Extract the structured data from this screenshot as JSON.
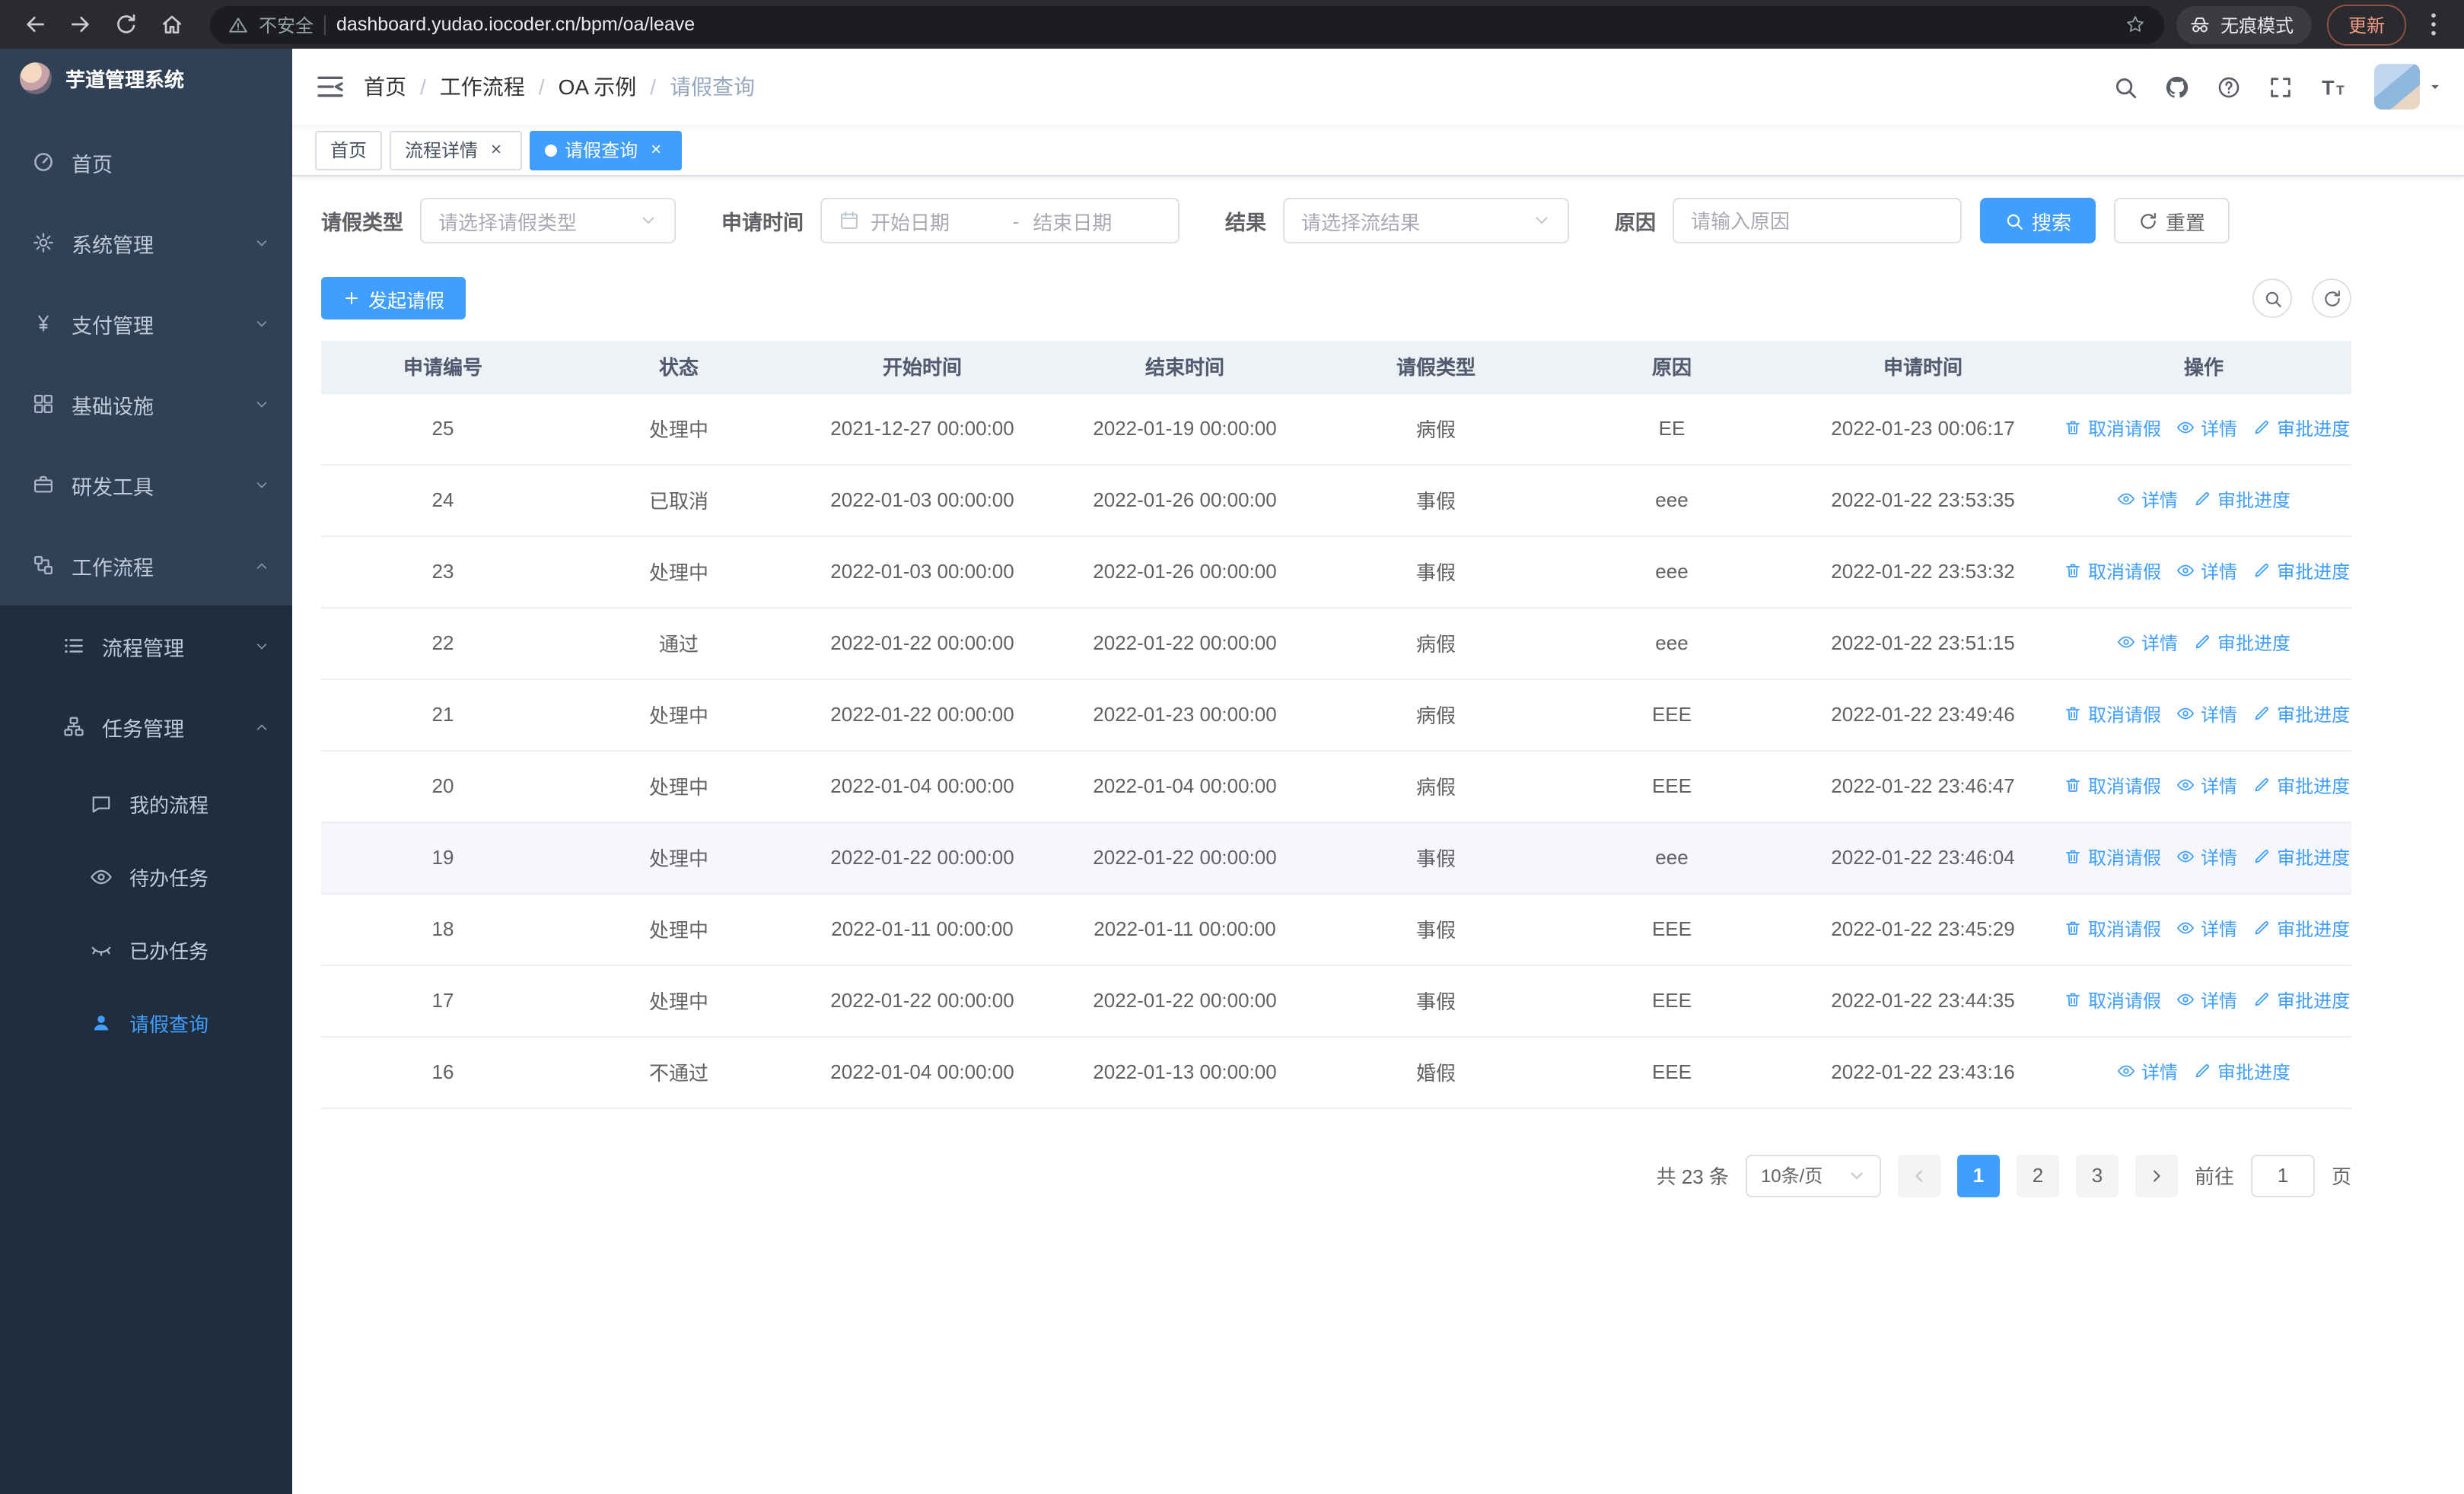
{
  "browser": {
    "security_label": "不安全",
    "url": "dashboard.yudao.iocoder.cn/bpm/oa/leave",
    "incognito_label": "无痕模式",
    "update_label": "更新"
  },
  "sidebar": {
    "title": "芋道管理系统",
    "items": [
      {
        "key": "home",
        "label": "首页",
        "icon": "dashboard-icon",
        "level": "top"
      },
      {
        "key": "system",
        "label": "系统管理",
        "icon": "gear-icon",
        "level": "top",
        "chevron": "down"
      },
      {
        "key": "payment",
        "label": "支付管理",
        "icon": "money-icon",
        "level": "top",
        "chevron": "down"
      },
      {
        "key": "infrastructure",
        "label": "基础设施",
        "icon": "grid-icon",
        "level": "top",
        "chevron": "down"
      },
      {
        "key": "dev-tools",
        "label": "研发工具",
        "icon": "toolbox-icon",
        "level": "top",
        "chevron": "down"
      },
      {
        "key": "workflow",
        "label": "工作流程",
        "icon": "workflow-icon",
        "level": "top",
        "chevron": "up"
      },
      {
        "key": "process-management",
        "label": "流程管理",
        "icon": "list-icon",
        "level": "sub",
        "chevron": "down"
      },
      {
        "key": "task-management",
        "label": "任务管理",
        "icon": "tasks-icon",
        "level": "sub",
        "chevron": "up"
      },
      {
        "key": "my-process",
        "label": "我的流程",
        "icon": "chat-icon",
        "level": "deep"
      },
      {
        "key": "todo-tasks",
        "label": "待办任务",
        "icon": "eye-icon",
        "level": "deep"
      },
      {
        "key": "done-tasks",
        "label": "已办任务",
        "icon": "eye-closed-icon",
        "level": "deep"
      },
      {
        "key": "leave-query",
        "label": "请假查询",
        "icon": "user-icon",
        "level": "deep",
        "active": true
      }
    ]
  },
  "header": {
    "breadcrumb": [
      "首页",
      "工作流程",
      "OA 示例",
      "请假查询"
    ]
  },
  "tabs": [
    {
      "key": "home",
      "label": "首页",
      "closable": false,
      "active": false
    },
    {
      "key": "process-detail",
      "label": "流程详情",
      "closable": true,
      "active": false
    },
    {
      "key": "leave-query",
      "label": "请假查询",
      "closable": true,
      "active": true
    }
  ],
  "filters": {
    "leave_type_label": "请假类型",
    "leave_type_placeholder": "请选择请假类型",
    "apply_time_label": "申请时间",
    "start_date_placeholder": "开始日期",
    "range_separator": "-",
    "end_date_placeholder": "结束日期",
    "result_label": "结果",
    "result_placeholder": "请选择流结果",
    "reason_label": "原因",
    "reason_placeholder": "请输入原因",
    "search_button": "搜索",
    "reset_button": "重置"
  },
  "toolbar": {
    "create_button": "发起请假"
  },
  "table": {
    "columns": [
      "申请编号",
      "状态",
      "开始时间",
      "结束时间",
      "请假类型",
      "原因",
      "申请时间",
      "操作"
    ],
    "op_labels": {
      "cancel": "取消请假",
      "detail": "详情",
      "progress": "审批进度"
    },
    "rows": [
      {
        "id": "25",
        "status": "处理中",
        "start": "2021-12-27 00:00:00",
        "end": "2022-01-19 00:00:00",
        "type": "病假",
        "reason": "EE",
        "apply_time": "2022-01-23 00:06:17",
        "ops": [
          "cancel",
          "detail",
          "progress"
        ]
      },
      {
        "id": "24",
        "status": "已取消",
        "start": "2022-01-03 00:00:00",
        "end": "2022-01-26 00:00:00",
        "type": "事假",
        "reason": "eee",
        "apply_time": "2022-01-22 23:53:35",
        "ops": [
          "detail",
          "progress"
        ]
      },
      {
        "id": "23",
        "status": "处理中",
        "start": "2022-01-03 00:00:00",
        "end": "2022-01-26 00:00:00",
        "type": "事假",
        "reason": "eee",
        "apply_time": "2022-01-22 23:53:32",
        "ops": [
          "cancel",
          "detail",
          "progress"
        ]
      },
      {
        "id": "22",
        "status": "通过",
        "start": "2022-01-22 00:00:00",
        "end": "2022-01-22 00:00:00",
        "type": "病假",
        "reason": "eee",
        "apply_time": "2022-01-22 23:51:15",
        "ops": [
          "detail",
          "progress"
        ]
      },
      {
        "id": "21",
        "status": "处理中",
        "start": "2022-01-22 00:00:00",
        "end": "2022-01-23 00:00:00",
        "type": "病假",
        "reason": "EEE",
        "apply_time": "2022-01-22 23:49:46",
        "ops": [
          "cancel",
          "detail",
          "progress"
        ]
      },
      {
        "id": "20",
        "status": "处理中",
        "start": "2022-01-04 00:00:00",
        "end": "2022-01-04 00:00:00",
        "type": "病假",
        "reason": "EEE",
        "apply_time": "2022-01-22 23:46:47",
        "ops": [
          "cancel",
          "detail",
          "progress"
        ]
      },
      {
        "id": "19",
        "status": "处理中",
        "start": "2022-01-22 00:00:00",
        "end": "2022-01-22 00:00:00",
        "type": "事假",
        "reason": "eee",
        "apply_time": "2022-01-22 23:46:04",
        "ops": [
          "cancel",
          "detail",
          "progress"
        ],
        "highlighted": true
      },
      {
        "id": "18",
        "status": "处理中",
        "start": "2022-01-11 00:00:00",
        "end": "2022-01-11 00:00:00",
        "type": "事假",
        "reason": "EEE",
        "apply_time": "2022-01-22 23:45:29",
        "ops": [
          "cancel",
          "detail",
          "progress"
        ]
      },
      {
        "id": "17",
        "status": "处理中",
        "start": "2022-01-22 00:00:00",
        "end": "2022-01-22 00:00:00",
        "type": "事假",
        "reason": "EEE",
        "apply_time": "2022-01-22 23:44:35",
        "ops": [
          "cancel",
          "detail",
          "progress"
        ]
      },
      {
        "id": "16",
        "status": "不通过",
        "start": "2022-01-04 00:00:00",
        "end": "2022-01-13 00:00:00",
        "type": "婚假",
        "reason": "EEE",
        "apply_time": "2022-01-22 23:43:16",
        "ops": [
          "detail",
          "progress"
        ]
      }
    ]
  },
  "pagination": {
    "total_text": "共 23 条",
    "page_size_text": "10条/页",
    "pages": [
      "1",
      "2",
      "3"
    ],
    "active_page": "1",
    "goto_label": "前往",
    "goto_value": "1",
    "goto_suffix": "页"
  }
}
